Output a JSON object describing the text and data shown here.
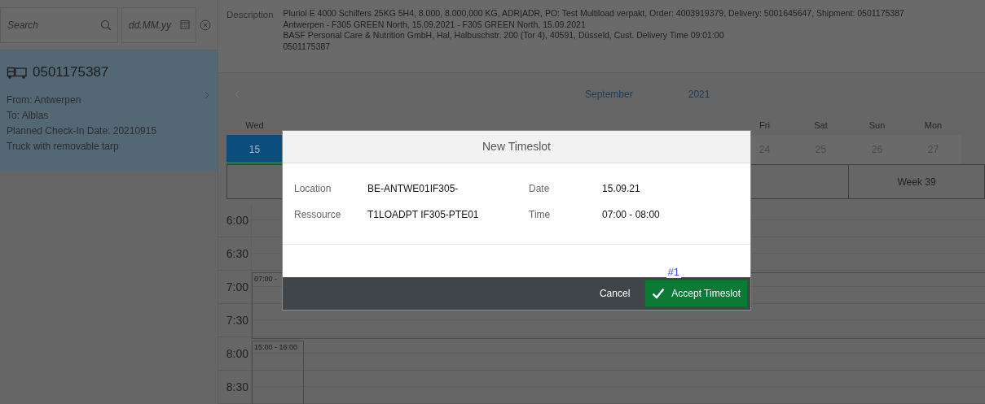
{
  "sidebar": {
    "search": {
      "placeholder": "Search"
    },
    "date_filter": {
      "placeholder": "dd.MM.yy"
    },
    "items": [
      {
        "title": "0501175387",
        "lines": [
          "From: Antwerpen",
          "To: Alblas",
          "Planned Check-In Date: 20210915",
          "Truck with removable tarp"
        ],
        "selected": true
      }
    ]
  },
  "description": {
    "label": "Description",
    "lines": [
      "Pluriol E 4000 Schilfers 25KG 5H4, 8.000, 8.000,000 KG, ADR|ADR, PO: Test Multiload verpakt, Order: 4003919379, Delivery: 5001645647, Shipment: 0501175387",
      "Antwerpen - F305 GREEN North, 15.09.2021 - F305 GREEN North, 15.09.2021",
      "BASF Personal Care & Nutrition GmbH, Hal, Halbuschstr. 200 (Tor 4), 40591, Düsseld, Cust. Delivery Time 09:01:00",
      "0501175387"
    ]
  },
  "calendar": {
    "month": "September",
    "year": "2021",
    "days": [
      {
        "weekday": "Wed",
        "date": "15",
        "selected": true
      }
    ],
    "days_right": [
      {
        "weekday": "Fri",
        "date": "24",
        "selected": false
      },
      {
        "weekday": "Sat",
        "date": "25",
        "selected": false
      },
      {
        "weekday": "Sun",
        "date": "26",
        "selected": false
      },
      {
        "weekday": "Mon",
        "date": "27",
        "selected": false
      }
    ],
    "week_label": "Week 39",
    "slots": [
      {
        "time": "6:00"
      },
      {
        "time": "6:30"
      },
      {
        "time": "7:00",
        "events": [
          {
            "label": "07:00 -",
            "kind": "wide"
          }
        ]
      },
      {
        "time": "7:30"
      },
      {
        "time": "8:00",
        "events": [
          {
            "label": "15:00 - 16:00",
            "kind": "narrow"
          }
        ]
      },
      {
        "time": "8:30"
      }
    ]
  },
  "dialog": {
    "title": "New Timeslot",
    "fields": [
      {
        "label": "Location",
        "value": "BE-ANTWE01IF305-"
      },
      {
        "label": "Date",
        "value": "15.09.21"
      },
      {
        "label": "Ressource",
        "value": "T1LOADPT IF305-PTE01"
      },
      {
        "label": "Time",
        "value": "07:00 - 08:00"
      }
    ],
    "buttons": [
      {
        "label": "Cancel",
        "kind": "plain"
      },
      {
        "label": "Accept Timeslot",
        "kind": "accept"
      }
    ],
    "annotation": "#1"
  }
}
